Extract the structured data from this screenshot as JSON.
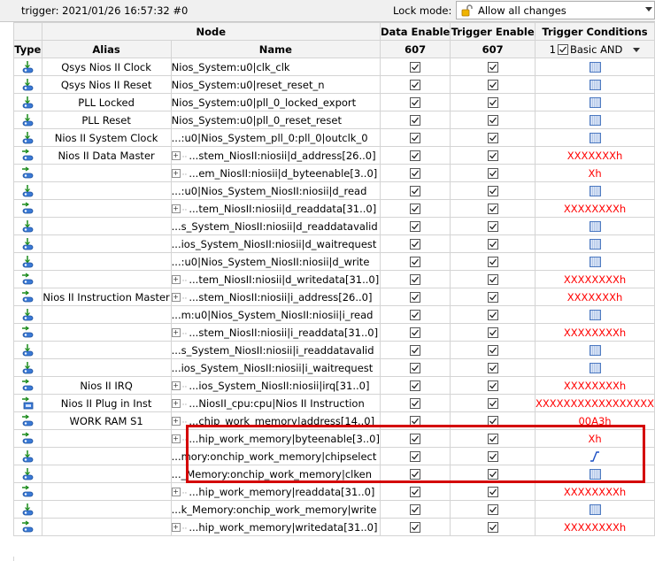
{
  "trigger_text": "trigger: 2021/01/26 16:57:32  #0",
  "lock_mode": {
    "label": "Lock mode:",
    "value": "Allow all changes"
  },
  "headers": {
    "type": "Type",
    "node": "Node",
    "alias": "Alias",
    "name": "Name",
    "data_enable": "Data Enable",
    "trigger_enable": "Trigger Enable",
    "trigger_conditions": "Trigger Conditions",
    "data_enable_count": "607",
    "trigger_enable_count": "607",
    "trigger_cond_index": "1",
    "trigger_cond_mode": "Basic AND"
  },
  "colors": {
    "value_red": "#ff0000",
    "highlight_box": "#d40000",
    "dontcare_blue": "#2a5fb5"
  },
  "rows": [
    {
      "type": "input",
      "alias": "Qsys Nios II Clock",
      "name": "Nios_System:u0|clk_clk",
      "group": false,
      "condition": "dontcare"
    },
    {
      "type": "input",
      "alias": "Qsys Nios II Reset",
      "name": "Nios_System:u0|reset_reset_n",
      "group": false,
      "condition": "dontcare"
    },
    {
      "type": "input",
      "alias": "PLL Locked",
      "name": "Nios_System:u0|pll_0_locked_export",
      "group": false,
      "condition": "dontcare"
    },
    {
      "type": "input",
      "alias": "PLL Reset",
      "name": "Nios_System:u0|pll_0_reset_reset",
      "group": false,
      "condition": "dontcare"
    },
    {
      "type": "input",
      "alias": "Nios II System Clock",
      "name": "...:u0|Nios_System_pll_0:pll_0|outclk_0",
      "group": false,
      "condition": "dontcare"
    },
    {
      "type": "bus",
      "alias": "Nios II Data Master",
      "name": "...stem_NiosII:niosii|d_address[26..0]",
      "group": true,
      "condition": "XXXXXXXh"
    },
    {
      "type": "bus",
      "alias": "",
      "name": "...em_NiosII:niosii|d_byteenable[3..0]",
      "group": true,
      "condition": "Xh"
    },
    {
      "type": "input",
      "alias": "",
      "name": "...:u0|Nios_System_NiosII:niosii|d_read",
      "group": false,
      "condition": "dontcare"
    },
    {
      "type": "bus",
      "alias": "",
      "name": "...tem_NiosII:niosii|d_readdata[31..0]",
      "group": true,
      "condition": "XXXXXXXXh"
    },
    {
      "type": "input",
      "alias": "",
      "name": "...s_System_NiosII:niosii|d_readdatavalid",
      "group": false,
      "condition": "dontcare"
    },
    {
      "type": "input",
      "alias": "",
      "name": "...ios_System_NiosII:niosii|d_waitrequest",
      "group": false,
      "condition": "dontcare"
    },
    {
      "type": "input",
      "alias": "",
      "name": "...:u0|Nios_System_NiosII:niosii|d_write",
      "group": false,
      "condition": "dontcare"
    },
    {
      "type": "bus",
      "alias": "",
      "name": "...tem_NiosII:niosii|d_writedata[31..0]",
      "group": true,
      "condition": "XXXXXXXXh"
    },
    {
      "type": "bus",
      "alias": "Nios II Instruction Master",
      "name": "...stem_NiosII:niosii|i_address[26..0]",
      "group": true,
      "condition": "XXXXXXXh"
    },
    {
      "type": "input",
      "alias": "",
      "name": "...m:u0|Nios_System_NiosII:niosii|i_read",
      "group": false,
      "condition": "dontcare"
    },
    {
      "type": "bus",
      "alias": "",
      "name": "...stem_NiosII:niosii|i_readdata[31..0]",
      "group": true,
      "condition": "XXXXXXXXh"
    },
    {
      "type": "input",
      "alias": "",
      "name": "...s_System_NiosII:niosii|i_readdatavalid",
      "group": false,
      "condition": "dontcare"
    },
    {
      "type": "input",
      "alias": "",
      "name": "...ios_System_NiosII:niosii|i_waitrequest",
      "group": false,
      "condition": "dontcare"
    },
    {
      "type": "bus",
      "alias": "Nios II IRQ",
      "name": "...ios_System_NiosII:niosii|irq[31..0]",
      "group": true,
      "condition": "XXXXXXXXh"
    },
    {
      "type": "plugin",
      "alias": "Nios II Plug in Inst",
      "name": "...NiosII_cpu:cpu|Nios II Instruction",
      "group": true,
      "condition": "XXXXXXXXXXXXXXXXX"
    },
    {
      "type": "bus",
      "alias": "WORK RAM S1",
      "name": "...chip_work_memory|address[14..0]",
      "group": true,
      "condition": "00A3h"
    },
    {
      "type": "bus",
      "alias": "",
      "name": "...hip_work_memory|byteenable[3..0]",
      "group": true,
      "condition": "Xh"
    },
    {
      "type": "input",
      "alias": "",
      "name": "...mory:onchip_work_memory|chipselect",
      "group": false,
      "condition": "rising"
    },
    {
      "type": "input",
      "alias": "",
      "name": "..._Memory:onchip_work_memory|clken",
      "group": false,
      "condition": "dontcare"
    },
    {
      "type": "bus",
      "alias": "",
      "name": "...hip_work_memory|readdata[31..0]",
      "group": true,
      "condition": "XXXXXXXXh"
    },
    {
      "type": "input",
      "alias": "",
      "name": "...k_Memory:onchip_work_memory|write",
      "group": false,
      "condition": "dontcare"
    },
    {
      "type": "bus",
      "alias": "",
      "name": "...hip_work_memory|writedata[31..0]",
      "group": true,
      "condition": "XXXXXXXXh"
    }
  ]
}
